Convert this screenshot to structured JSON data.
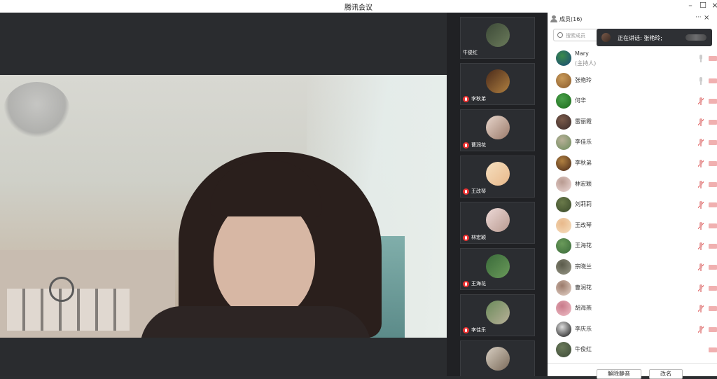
{
  "window": {
    "title": "腾讯会议",
    "minimize_glyph": "–",
    "maximize_glyph": "☐",
    "close_glyph": "×"
  },
  "thumbnails": [
    {
      "name": "牛俊红",
      "muted": false,
      "colors": [
        "#3d4a38",
        "#6a7a5a"
      ]
    },
    {
      "name": "李秋弟",
      "muted": true,
      "colors": [
        "#4a2a1a",
        "#b08040"
      ]
    },
    {
      "name": "曹润花",
      "muted": true,
      "colors": [
        "#e8d6cc",
        "#9a7a6a"
      ]
    },
    {
      "name": "王改琴",
      "muted": true,
      "colors": [
        "#f6e0c0",
        "#e8b88a"
      ]
    },
    {
      "name": "林宏颖",
      "muted": true,
      "colors": [
        "#eedad8",
        "#b89a90"
      ]
    },
    {
      "name": "王海花",
      "muted": true,
      "colors": [
        "#3a6a3a",
        "#6a9a5a"
      ]
    },
    {
      "name": "李佳乐",
      "muted": true,
      "colors": [
        "#6a8a5a",
        "#b8b098"
      ]
    },
    {
      "name": "",
      "muted": false,
      "colors": [
        "#d8cfc2",
        "#7a6a5a"
      ]
    }
  ],
  "panel": {
    "title": "成员(16)",
    "more_glyph": "···",
    "close_glyph": "×",
    "search_placeholder": "搜索成员"
  },
  "speaking": {
    "text": "正在讲话: 张艳玲;"
  },
  "members": [
    {
      "name": "Mary",
      "role": "(主持人)",
      "mic": "on",
      "colors": [
        "#1a4a7a",
        "#3a8a4a"
      ]
    },
    {
      "name": "张艳玲",
      "role": "",
      "mic": "on",
      "colors": [
        "#8a5a2a",
        "#c89a5a"
      ]
    },
    {
      "name": "何华",
      "role": "",
      "mic": "muted",
      "colors": [
        "#1a6a1a",
        "#4aa04a"
      ]
    },
    {
      "name": "雷丽霞",
      "role": "",
      "mic": "muted",
      "colors": [
        "#3a2a2a",
        "#7a5a4a"
      ]
    },
    {
      "name": "李佳乐",
      "role": "",
      "mic": "muted",
      "colors": [
        "#6a8a5a",
        "#b8b098"
      ]
    },
    {
      "name": "李秋弟",
      "role": "",
      "mic": "muted",
      "colors": [
        "#4a2a1a",
        "#b08040"
      ]
    },
    {
      "name": "林宏颖",
      "role": "",
      "mic": "muted",
      "colors": [
        "#eedad8",
        "#b89a90"
      ]
    },
    {
      "name": "刘莉莉",
      "role": "",
      "mic": "muted",
      "colors": [
        "#3a4a2a",
        "#6a7a4a"
      ]
    },
    {
      "name": "王改琴",
      "role": "",
      "mic": "muted",
      "colors": [
        "#f6e0c0",
        "#e8b88a"
      ]
    },
    {
      "name": "王海花",
      "role": "",
      "mic": "muted",
      "colors": [
        "#3a6a3a",
        "#6a9a5a"
      ]
    },
    {
      "name": "宗晓兰",
      "role": "",
      "mic": "muted",
      "colors": [
        "#9a9a8a",
        "#5a5a4a"
      ]
    },
    {
      "name": "曹润花",
      "role": "",
      "mic": "muted",
      "colors": [
        "#e8d6cc",
        "#9a7a6a"
      ]
    },
    {
      "name": "胡海燕",
      "role": "",
      "mic": "muted",
      "colors": [
        "#f0c0c8",
        "#c87a8a"
      ]
    },
    {
      "name": "李庆乐",
      "role": "",
      "mic": "muted",
      "colors": [
        "#111111",
        "#dddddd"
      ]
    },
    {
      "name": "牛俊红",
      "role": "",
      "mic": "none",
      "colors": [
        "#3d4a38",
        "#6a7a5a"
      ]
    }
  ],
  "footer": {
    "unmute_all": "解除静音",
    "rename": "改名"
  }
}
